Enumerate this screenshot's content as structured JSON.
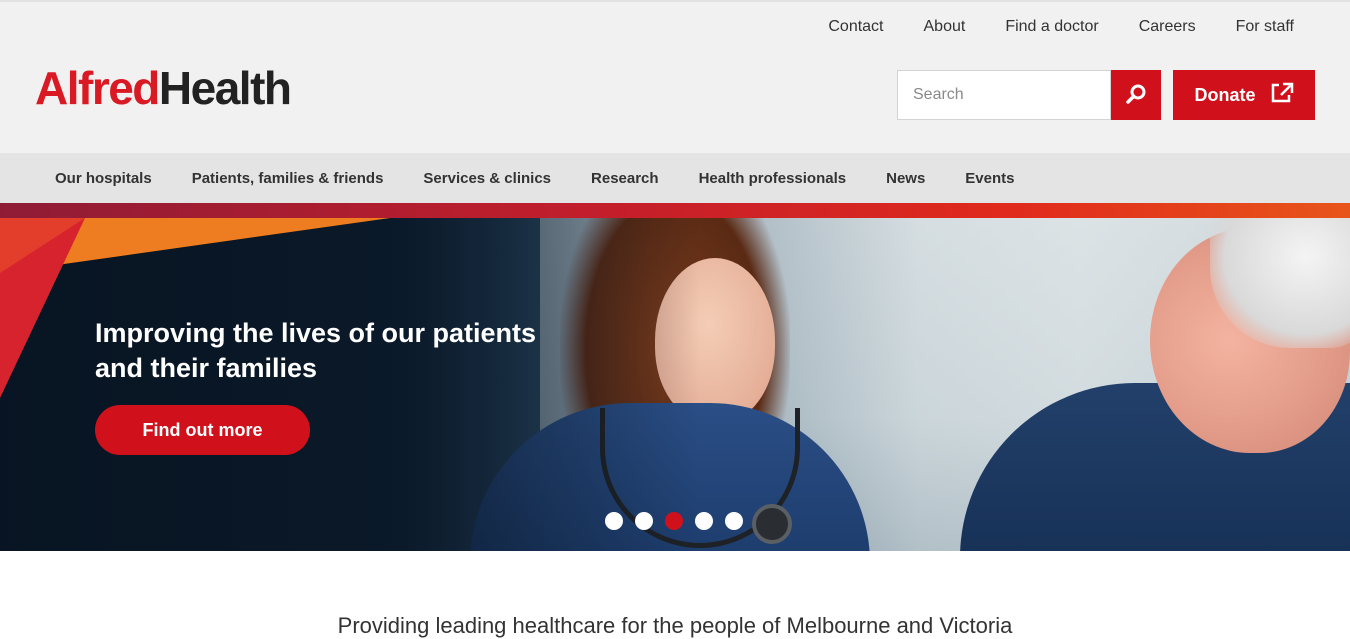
{
  "utility_nav": [
    "Contact",
    "About",
    "Find a doctor",
    "Careers",
    "For staff"
  ],
  "logo": {
    "part1": "Alfred",
    "part2": "Health"
  },
  "search": {
    "placeholder": "Search"
  },
  "donate": {
    "label": "Donate"
  },
  "main_nav": [
    "Our hospitals",
    "Patients, families & friends",
    "Services & clinics",
    "Research",
    "Health professionals",
    "News",
    "Events"
  ],
  "hero": {
    "title": "Improving the lives of our patients and their families",
    "cta_label": "Find out more",
    "slide_count": 5,
    "active_slide": 3
  },
  "tagline": "Providing leading healthcare for the people of Melbourne and Victoria",
  "colors": {
    "brand_red": "#d0111b",
    "accent_orange": "#ee7d22",
    "nav_bg": "#e4e4e4",
    "header_bg": "#f1f1f1"
  },
  "icons": {
    "search": "search-icon",
    "external": "external-link-icon"
  }
}
